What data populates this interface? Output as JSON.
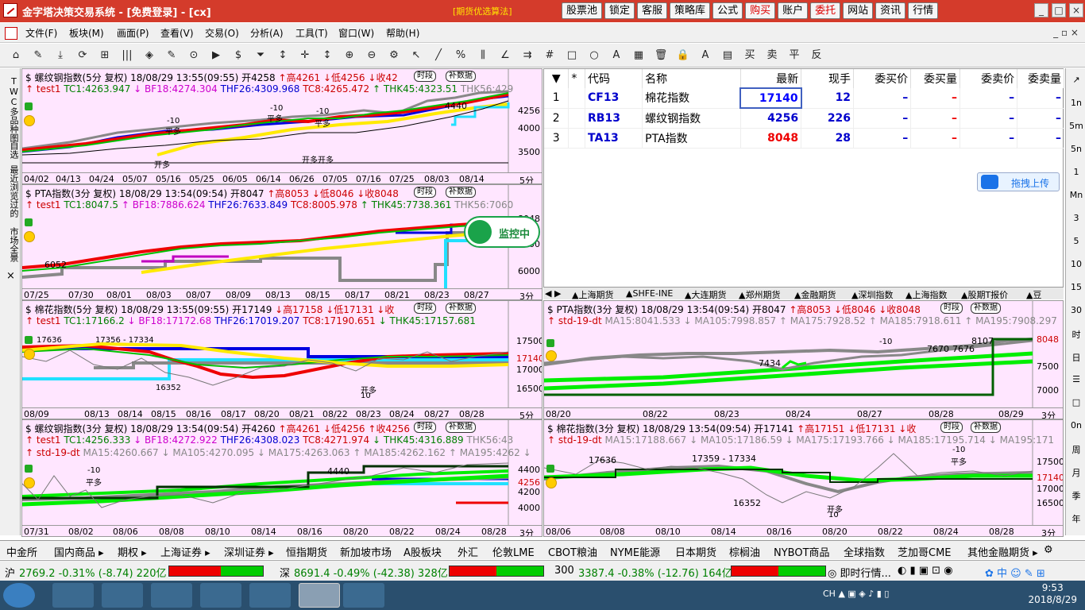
{
  "window": {
    "title": "金字塔决策交易系统 - [免费登录] - [cx]",
    "warning": "[期货优选算法]",
    "top_buttons": [
      "股票池",
      "锁定",
      "客服",
      "策略库",
      "公式",
      "购买",
      "账户",
      "委托",
      "网站",
      "资讯",
      "行情"
    ],
    "controls": [
      "_",
      "□",
      "×"
    ]
  },
  "menu": {
    "items": [
      "文件(F)",
      "板块(M)",
      "画面(P)",
      "查看(V)",
      "交易(O)",
      "分析(A)",
      "工具(T)",
      "窗口(W)",
      "帮助(H)"
    ],
    "mdi": "_ ▫ ×"
  },
  "toolbar": {
    "glyphs": [
      "⌂",
      "✎",
      "⤓",
      "⟳",
      "⊞",
      "|||",
      "◈",
      "✎",
      "⊙",
      "▶",
      "$",
      "⏷",
      "↕",
      "✛",
      "↕",
      "⊕",
      "⊖",
      "⚙",
      "↖",
      "╱",
      "%",
      "⫼",
      "∠",
      "⇉",
      "#",
      "□",
      "○",
      "A",
      "▦",
      "🗑",
      "🔒",
      "A",
      "▤",
      "买",
      "卖",
      "平",
      "反"
    ]
  },
  "left_tabs": [
    "TWC多品种图",
    "自选",
    "最近浏览过的",
    "市场全景"
  ],
  "right_tabs": [
    "↗",
    "1n",
    "5m",
    "5n",
    "1",
    "Mn",
    "3",
    "5",
    "10",
    "15",
    "30",
    "时",
    "日",
    "☰",
    "□",
    "0n",
    "周",
    "月",
    "季",
    "年"
  ],
  "panels": {
    "p1": {
      "title": "$ 螺纹钢指数(5分 复权) 18/08/29 13:55(09:55)",
      "open": "开4258",
      "high": "↑高4261",
      "low": "↓低4256",
      "close": "↓收42",
      "chip1": "时段",
      "chip2": "补数据",
      "ind": "↑ test1",
      "tc1": "TC1:4263.947",
      "bf18": "↓ BF18:4274.304",
      "thf26": "THF26:4309.968",
      "tc8": "TC8:4265.472",
      "thk45": "↑ THK45:4323.51",
      "thk56": "THK56:429",
      "xlabels": [
        "04/02",
        "04/13",
        "04/24",
        "05/07",
        "05/16",
        "05/25",
        "06/05",
        "06/14",
        "06/26",
        "07/05",
        "07/16",
        "07/25",
        "08/03",
        "08/14"
      ],
      "ylabels": [
        "4256",
        "4000",
        "3500"
      ],
      "period": "5分",
      "ann": [
        "-10",
        "平多",
        "-10",
        "平多",
        "-10",
        "平多",
        "开多",
        "开多开多"
      ],
      "tag": "4440"
    },
    "p2": {
      "title": "$ PTA指数(3分 复权) 18/08/29 13:54(09:54)",
      "open": "开8047",
      "high": "↑高8053",
      "low": "↓低8046",
      "close": "↓收8048",
      "chip1": "时段",
      "chip2": "补数据",
      "ind": "↑ test1",
      "tc1": "TC1:8047.5",
      "bf18": "↑ BF18:7886.624",
      "thf26": "THF26:7633.849",
      "tc8": "TC8:8005.978",
      "thk45": "↑ THK45:7738.361",
      "thk56": "THK56:7060",
      "xlabels": [
        "07/25",
        "07/30",
        "08/01",
        "08/03",
        "08/07",
        "08/09",
        "08/13",
        "08/15",
        "08/17",
        "08/21",
        "08/23",
        "08/27"
      ],
      "ylabels": [
        "8048",
        "7000",
        "6000"
      ],
      "period": "3分",
      "tag": "6052"
    },
    "p3": {
      "title": "$ 棉花指数(5分 复权) 18/08/29 13:55(09:55)",
      "open": "开17149",
      "high": "↓高17158",
      "low": "↓低17131",
      "close": "↓收",
      "chip1": "时段",
      "chip2": "补数据",
      "ind": "↑ test1",
      "tc1": "TC1:17166.2",
      "bf18": "↓ BF18:17172.68",
      "thf26": "THF26:17019.207",
      "tc8": "TC8:17190.651",
      "thk45": "↓ THK45:17157.681",
      "xlabels": [
        "08/09",
        "08/13",
        "08/14",
        "08/15",
        "08/16",
        "08/17",
        "08/20",
        "08/21",
        "08/22",
        "08/23",
        "08/24",
        "08/27",
        "08/28"
      ],
      "ylabels": [
        "17500",
        "17140",
        "17000",
        "16500"
      ],
      "period": "5分",
      "ann": [
        "17636",
        "17356 - 17334",
        "16352",
        "开多",
        "10"
      ]
    },
    "p4": {
      "title": "$ PTA指数(3分 复权) 18/08/29 13:54(09:54)",
      "open": "开8047",
      "high": "↑高8053",
      "low": "↓低8046",
      "close": "↓收8048",
      "chip1": "时段",
      "chip2": "补数据",
      "ind": "↑ std-19-dt",
      "ma": "MA15:8041.533 ↓ MA105:7998.857 ↑ MA175:7928.52 ↑ MA185:7918.611 ↑ MA195:7908.297",
      "xlabels": [
        "08/20",
        "08/22",
        "08/23",
        "08/24",
        "08/27",
        "08/28",
        "08/29"
      ],
      "ylabels": [
        "8048",
        "7500",
        "7000"
      ],
      "period": "3分",
      "ann": [
        "7434",
        "7670",
        "7676",
        "8107",
        "-10"
      ]
    },
    "p5": {
      "title": "$ 螺纹钢指数(3分 复权) 18/08/29 13:54(09:54)",
      "open": "开4260",
      "high": "↑高4261",
      "low": "↓低4256",
      "close": "↑收4256",
      "chip1": "时段",
      "chip2": "补数据",
      "ind": "↑ test1",
      "tc1": "TC1:4256.333",
      "bf18": "↓ BF18:4272.922",
      "thf26": "THF26:4308.023",
      "tc8": "TC8:4271.974",
      "thk45": "↓ THK45:4316.889",
      "thk56": "THK56:43",
      "ind2": "↑ std-19-dt",
      "ma": "MA15:4260.667 ↓ MA105:4270.095 ↓ MA175:4263.063 ↑ MA185:4262.162 ↑ MA195:4262 ↓",
      "xlabels": [
        "07/31",
        "08/02",
        "08/06",
        "08/08",
        "08/10",
        "08/14",
        "08/16",
        "08/20",
        "08/22",
        "08/24",
        "08/28"
      ],
      "ylabels": [
        "4400",
        "4256",
        "4200",
        "4000"
      ],
      "period": "3分",
      "ann": [
        "-10",
        "平多",
        "4440"
      ]
    },
    "p6": {
      "title": "$ 棉花指数(3分 复权) 18/08/29 13:54(09:54)",
      "open": "开17141",
      "high": "↑高17151",
      "low": "↓低17131",
      "close": "↓收",
      "chip1": "时段",
      "chip2": "补数据",
      "ind": "↑ std-19-dt",
      "ma": "MA15:17188.667 ↓ MA105:17186.59 ↓ MA175:17193.766 ↓ MA185:17195.714 ↓ MA195:171",
      "xlabels": [
        "08/06",
        "08/08",
        "08/10",
        "08/14",
        "08/16",
        "08/20",
        "08/22",
        "08/24",
        "08/28"
      ],
      "ylabels": [
        "17500",
        "17140",
        "17000",
        "16500"
      ],
      "period": "3分",
      "ann": [
        "17636",
        "17359 - 17334",
        "16352",
        "开多",
        "10",
        "-10",
        "平多"
      ]
    }
  },
  "quotes": {
    "headers": [
      "",
      "*",
      "代码",
      "名称",
      "最新",
      "现手",
      "委买价",
      "委买量",
      "委卖价",
      "委卖量"
    ],
    "rows": [
      {
        "no": "1",
        "code": "CF13",
        "name": "棉花指数",
        "last": "17140",
        "vol": "12",
        "bid": "–",
        "bidv": "–",
        "ask": "–",
        "askv": "–"
      },
      {
        "no": "2",
        "code": "RB13",
        "name": "螺纹钢指数",
        "last": "4256",
        "vol": "226",
        "bid": "–",
        "bidv": "–",
        "ask": "–",
        "askv": "–"
      },
      {
        "no": "3",
        "code": "TA13",
        "name": "PTA指数",
        "last": "8048",
        "vol": "28",
        "bid": "–",
        "bidv": "–",
        "ask": "–",
        "askv": "–"
      }
    ],
    "exch_tabs": [
      "◀ ▶",
      "▲上海期货",
      "▲SHFE-INE",
      "▲大连期货",
      "▲郑州期货",
      "▲金融期货",
      "▲深圳指数",
      "▲上海指数",
      "▲股期T报价",
      "▲豆"
    ],
    "upload": "拖拽上传",
    "monitor": "监控中"
  },
  "bottom_tabs": [
    "中金所",
    "国内商品 ▸",
    "期权 ▸",
    "上海证券 ▸",
    "深圳证券 ▸",
    "恒指期货",
    "新加坡市场",
    "A股板块",
    "外汇",
    "伦敦LME",
    "CBOT粮油",
    "NYME能源",
    "日本期货",
    "棕榈油",
    "NYBOT商品",
    "全球指数",
    "芝加哥CME",
    "其他金融期货 ▸"
  ],
  "status": {
    "sh_label": "沪",
    "sh_val": "2769.2 -0.31% (-8.74) 220亿",
    "sz_label": "深",
    "sz_val": "8691.4 -0.49% (-42.38) 328亿",
    "hs_label": "300",
    "hs_val": "3387.4 -0.38% (-12.76) 164亿",
    "news": "即时行情...",
    "sh_up": 0.55,
    "sz_up": 0.5,
    "hs_up": 0.5
  },
  "taskbar": {
    "lang": "CH",
    "time": "9:53",
    "date": "2018/8/29"
  },
  "colors": {
    "title_red": "#d43b2b",
    "panel_bg": "#ffe6ff",
    "up": "#e00000"
  }
}
